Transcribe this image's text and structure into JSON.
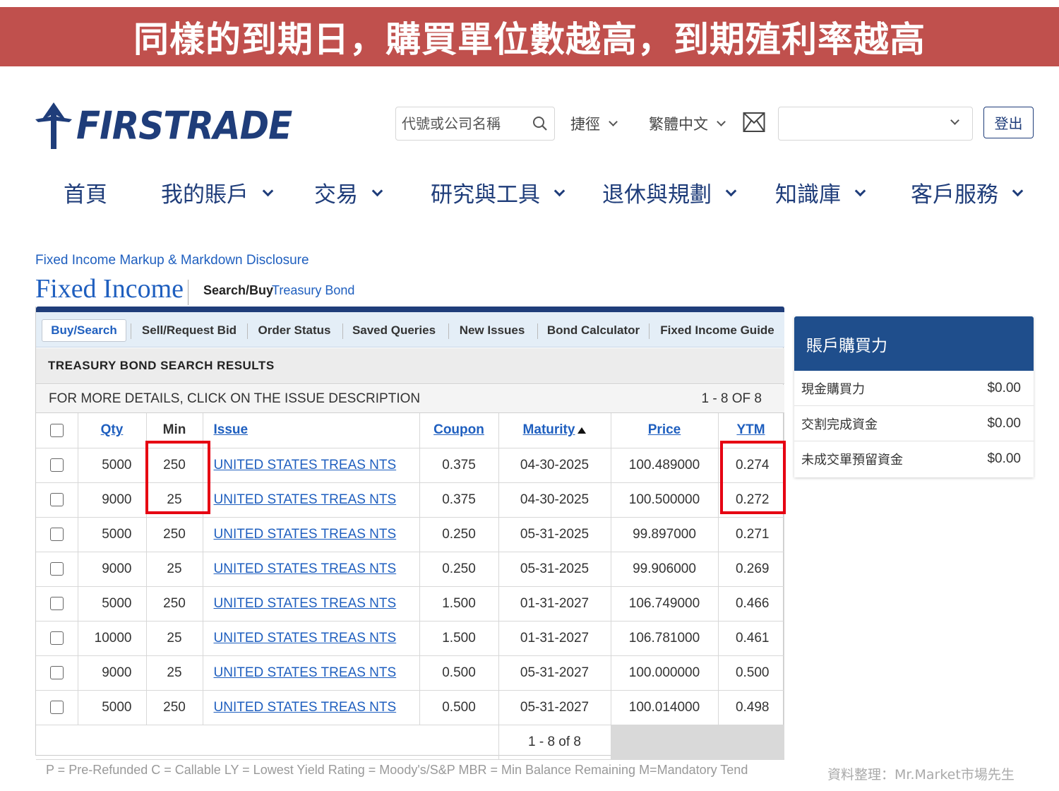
{
  "banner": "同樣的到期日，購買單位數越高，到期殖利率越高",
  "logo": {
    "text": "FIRSTRADE"
  },
  "header": {
    "search_placeholder": "代號或公司名稱",
    "shortcuts": "捷徑",
    "language": "繁體中文",
    "account_select": "",
    "logout": "登出"
  },
  "main_nav": [
    "首頁",
    "我的賬戶",
    "交易",
    "研究與工具",
    "退休與規劃",
    "知識庫",
    "客戶服務"
  ],
  "page": {
    "disclosure": "Fixed Income Markup & Markdown Disclosure",
    "title": "Fixed Income",
    "breadcrumb_a": "Search/Buy",
    "breadcrumb_b": "Treasury Bond"
  },
  "tabs": [
    "Buy/Search",
    "Sell/Request Bid",
    "Order Status",
    "Saved Queries",
    "New Issues",
    "Bond Calculator",
    "Fixed Income Guide"
  ],
  "results": {
    "heading": "TREASURY BOND SEARCH RESULTS",
    "details_text": "FOR MORE DETAILS, CLICK ON THE ISSUE DESCRIPTION",
    "count_text": "1 - 8 OF 8",
    "columns": {
      "qty": "Qty",
      "min": "Min",
      "issue": "Issue",
      "coupon": "Coupon",
      "maturity": "Maturity",
      "price": "Price",
      "ytm": "YTM"
    },
    "rows": [
      {
        "qty": "5000",
        "min": "250",
        "issue": "UNITED STATES TREAS NTS",
        "coupon": "0.375",
        "maturity": "04-30-2025",
        "price": "100.489000",
        "ytm": "0.274"
      },
      {
        "qty": "9000",
        "min": "25",
        "issue": "UNITED STATES TREAS NTS",
        "coupon": "0.375",
        "maturity": "04-30-2025",
        "price": "100.500000",
        "ytm": "0.272"
      },
      {
        "qty": "5000",
        "min": "250",
        "issue": "UNITED STATES TREAS NTS",
        "coupon": "0.250",
        "maturity": "05-31-2025",
        "price": "99.897000",
        "ytm": "0.271"
      },
      {
        "qty": "9000",
        "min": "25",
        "issue": "UNITED STATES TREAS NTS",
        "coupon": "0.250",
        "maturity": "05-31-2025",
        "price": "99.906000",
        "ytm": "0.269"
      },
      {
        "qty": "5000",
        "min": "250",
        "issue": "UNITED STATES TREAS NTS",
        "coupon": "1.500",
        "maturity": "01-31-2027",
        "price": "106.749000",
        "ytm": "0.466"
      },
      {
        "qty": "10000",
        "min": "25",
        "issue": "UNITED STATES TREAS NTS",
        "coupon": "1.500",
        "maturity": "01-31-2027",
        "price": "106.781000",
        "ytm": "0.461"
      },
      {
        "qty": "9000",
        "min": "25",
        "issue": "UNITED STATES TREAS NTS",
        "coupon": "0.500",
        "maturity": "05-31-2027",
        "price": "100.000000",
        "ytm": "0.500"
      },
      {
        "qty": "5000",
        "min": "250",
        "issue": "UNITED STATES TREAS NTS",
        "coupon": "0.500",
        "maturity": "05-31-2027",
        "price": "100.014000",
        "ytm": "0.498"
      }
    ],
    "footer_count": "1 - 8 of 8"
  },
  "legend": "P = Pre-Refunded    C = Callable    LY = Lowest Yield    Rating = Moody's/S&P    MBR = Min Balance Remaining    M=Mandatory Tend",
  "buying_power": {
    "title": "賬戶購買力",
    "rows": [
      {
        "label": "現金購買力",
        "value": "$0.00"
      },
      {
        "label": "交割完成資金",
        "value": "$0.00"
      },
      {
        "label": "未成交單預留資金",
        "value": "$0.00"
      }
    ]
  },
  "credit": "資料整理：Mr.Market市場先生",
  "colors": {
    "banner": "#c0504d",
    "brand": "#1f3d7a",
    "link": "#1f5fbf",
    "highlight": "#e60012"
  }
}
